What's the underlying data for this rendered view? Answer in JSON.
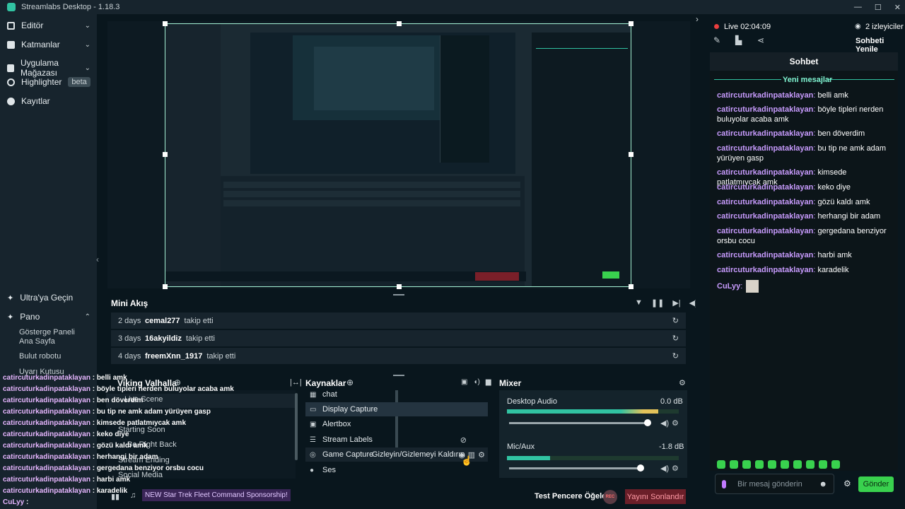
{
  "window": {
    "title": "Streamlabs Desktop - 1.18.3"
  },
  "nav": {
    "items": [
      {
        "label": "Editör"
      },
      {
        "label": "Katmanlar"
      },
      {
        "label": "Uygulama Mağazası"
      },
      {
        "label": "Highlighter",
        "badge": "beta"
      },
      {
        "label": "Kayıtlar"
      }
    ],
    "ultra": "Ultra'ya Geçin",
    "pano": "Pano",
    "sub": [
      "Gösterge Paneli Ana Sayfa",
      "Bulut robotu",
      "Uyarı Kutusu"
    ]
  },
  "mini_akis": {
    "title": "Mini Akış",
    "rows": [
      {
        "days": "2 days",
        "name": "cemal277",
        "action": "takip etti"
      },
      {
        "days": "3 days",
        "name": "16akyildiz",
        "action": "takip etti"
      },
      {
        "days": "4 days",
        "name": "freemXnn_1917",
        "action": "takip etti"
      }
    ]
  },
  "scenes": {
    "title": "Viking Valhalla",
    "items": [
      "Live Scene",
      "Starting Soon",
      "Be Right Back",
      "Stream Ending",
      "Social Media"
    ]
  },
  "sources": {
    "title": "Kaynaklar",
    "items": [
      "chat",
      "Display Capture",
      "Alertbox",
      "Stream Labels",
      "Game Capture",
      "Ses"
    ],
    "tooltip": "Gizleyin/Gizlemeyi Kaldırın"
  },
  "mixer": {
    "title": "Mixer",
    "channels": [
      {
        "name": "Desktop Audio",
        "db": "0.0 dB",
        "level": 0.88,
        "volume": 0.98
      },
      {
        "name": "Mic/Aux",
        "db": "-1.8 dB",
        "level": 0.25,
        "volume": 0.93
      }
    ]
  },
  "footer": {
    "news": "NEW Star Trek Fleet Command Sponsorship!",
    "test": "Test Pencere Öğeleri",
    "rec": "REC",
    "end": "Yayını Sonlandır"
  },
  "overlay_chat": [
    {
      "u": "catircuturkadinpataklayan",
      "m": "belli amk"
    },
    {
      "u": "catircuturkadinpataklayan",
      "m": "böyle tipleri nerden buluyolar acaba amk"
    },
    {
      "u": "catircuturkadinpataklayan",
      "m": "ben döverdim"
    },
    {
      "u": "catircuturkadinpataklayan",
      "m": "bu tip ne amk adam yürüyen gasp"
    },
    {
      "u": "catircuturkadinpataklayan",
      "m": "kimsede patlatmıycak amk"
    },
    {
      "u": "catircuturkadinpataklayan",
      "m": "keko diye"
    },
    {
      "u": "catircuturkadinpataklayan",
      "m": "gözü kaldı amk"
    },
    {
      "u": "catircuturkadinpataklayan",
      "m": "herhangi bir adam"
    },
    {
      "u": "catircuturkadinpataklayan",
      "m": "gergedana benziyor orsbu cocu"
    },
    {
      "u": "catircuturkadinpataklayan",
      "m": "harbi amk"
    },
    {
      "u": "catircuturkadinpataklayan",
      "m": "karadelik"
    },
    {
      "u": "CuLyy",
      "m": ""
    }
  ],
  "live": {
    "status": "Live",
    "time": "02:04:09",
    "viewers": "2 izleyiciler",
    "refresh": "Sohbeti Yenile"
  },
  "chat": {
    "title": "Sohbet",
    "new_messages": "Yeni mesajlar",
    "messages": [
      {
        "u": "catircuturkadinpataklayan",
        "m": "belli amk"
      },
      {
        "u": "catircuturkadinpataklayan",
        "m": "böyle tipleri nerden buluyolar acaba amk"
      },
      {
        "u": "catircuturkadinpataklayan",
        "m": "ben döverdim"
      },
      {
        "u": "catircuturkadinpataklayan",
        "m": "bu tip ne amk adam yürüyen gasp"
      },
      {
        "u": "catircuturkadinpataklayan",
        "m": "kimsede patlatmıycak amk"
      },
      {
        "u": "catircuturkadinpataklayan",
        "m": "keko diye"
      },
      {
        "u": "catircuturkadinpataklayan",
        "m": "gözü kaldı amk"
      },
      {
        "u": "catircuturkadinpataklayan",
        "m": "herhangi bir adam"
      },
      {
        "u": "catircuturkadinpataklayan",
        "m": "gergedana benziyor orsbu cocu"
      },
      {
        "u": "catircuturkadinpataklayan",
        "m": "harbi amk"
      },
      {
        "u": "catircuturkadinpataklayan",
        "m": "karadelik"
      },
      {
        "u": "CuLyy",
        "m": ""
      }
    ],
    "placeholder": "Bir mesaj gönderin",
    "send": "Gönder"
  },
  "colors": {
    "accent": "#80f5d2",
    "green": "#31c3a2",
    "live": "#ea3e3e",
    "end": "#7a1f29",
    "username": "#c99cff"
  }
}
